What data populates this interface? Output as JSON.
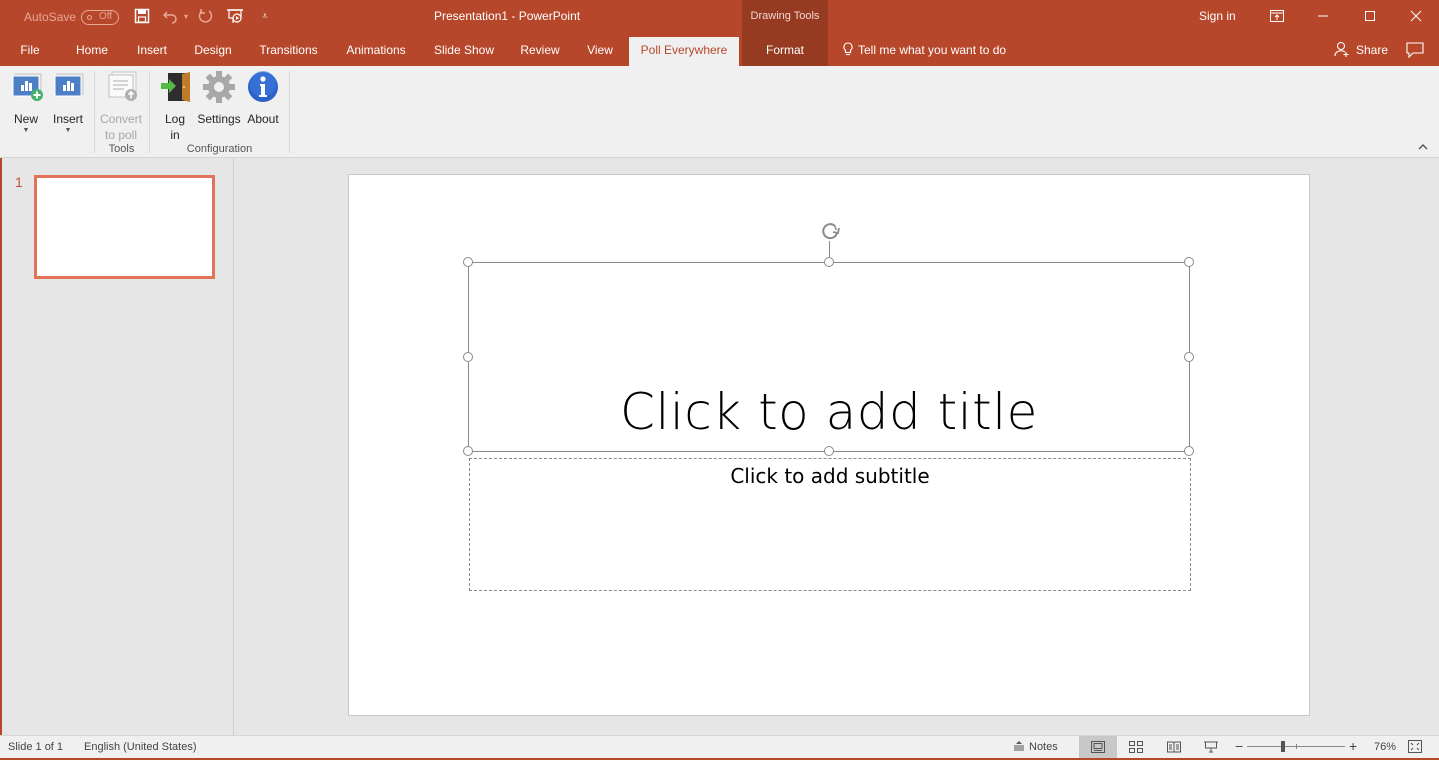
{
  "titlebar": {
    "autosave_label": "AutoSave",
    "autosave_state": "Off",
    "document_title": "Presentation1  -  PowerPoint",
    "contextual_group": "Drawing Tools",
    "sign_in": "Sign in",
    "icons": {
      "save": "save-icon",
      "undo": "undo-icon",
      "redo": "redo-icon",
      "present": "start-from-beginning-icon",
      "customize": "customize-qat-icon"
    }
  },
  "tabs": [
    {
      "label": "File",
      "active": false
    },
    {
      "label": "Home",
      "active": false
    },
    {
      "label": "Insert",
      "active": false
    },
    {
      "label": "Design",
      "active": false
    },
    {
      "label": "Transitions",
      "active": false
    },
    {
      "label": "Animations",
      "active": false
    },
    {
      "label": "Slide Show",
      "active": false
    },
    {
      "label": "Review",
      "active": false
    },
    {
      "label": "View",
      "active": false
    },
    {
      "label": "Poll Everywhere",
      "active": true
    },
    {
      "label": "Format",
      "active": false
    }
  ],
  "tell_me": "Tell me what you want to do",
  "share": "Share",
  "ribbon": {
    "buttons": {
      "new": {
        "label": "New",
        "has_dropdown": true
      },
      "insert": {
        "label": "Insert",
        "has_dropdown": true
      },
      "convert": {
        "label_line1": "Convert",
        "label_line2": "to poll",
        "enabled": false
      },
      "login": {
        "label_line1": "Log",
        "label_line2": "in"
      },
      "settings": {
        "label": "Settings"
      },
      "about": {
        "label": "About"
      }
    },
    "groups": {
      "tools": "Tools",
      "configuration": "Configuration"
    }
  },
  "thumbnails": [
    {
      "number": "1",
      "selected": true
    }
  ],
  "slide": {
    "title_placeholder": "Click to add title",
    "subtitle_placeholder": "Click to add subtitle"
  },
  "statusbar": {
    "slide_info": "Slide 1 of 1",
    "language": "English (United States)",
    "notes": "Notes",
    "zoom_percent": "76%",
    "zoom_value": 76
  },
  "colors": {
    "accent": "#b7472a",
    "contextual_tab": "#963a22",
    "thumbnail_border": "#e0735a",
    "ribbon_bg": "#f0f0f0"
  }
}
